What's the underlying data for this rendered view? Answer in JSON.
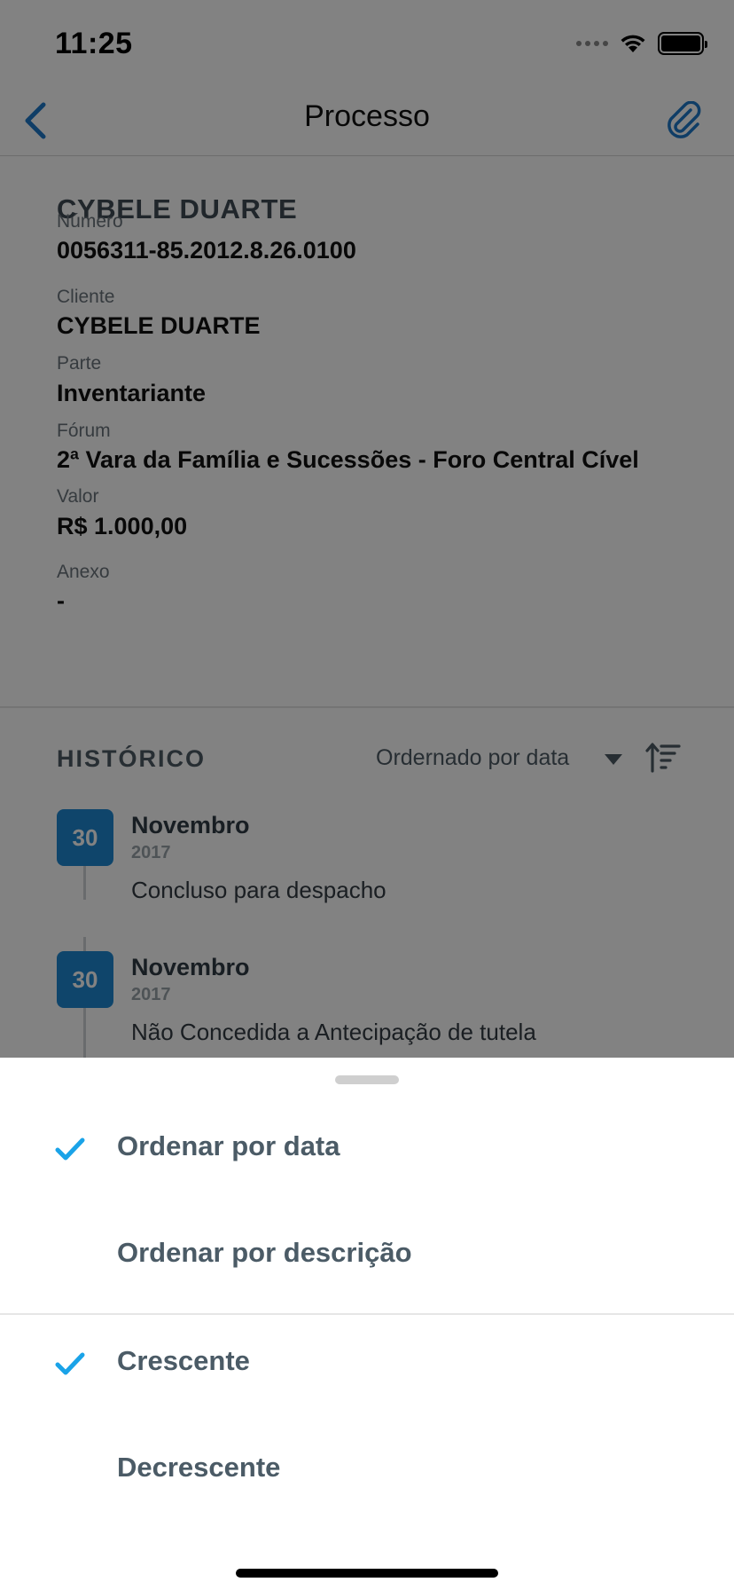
{
  "status_bar": {
    "time": "11:25"
  },
  "nav": {
    "title": "Processo",
    "back_icon": "chevron-left-icon",
    "attach_icon": "paperclip-icon",
    "accent_color": "#1e78c8"
  },
  "process": {
    "client_title": "CYBELE DUARTE",
    "fields": [
      {
        "label": "Número",
        "value": "0056311-85.2012.8.26.0100"
      },
      {
        "label": "Cliente",
        "value": "CYBELE DUARTE"
      },
      {
        "label": "Parte",
        "value": "Inventariante"
      },
      {
        "label": "Fórum",
        "value": "2ª Vara da Família e Sucessões - Foro Central Cível"
      },
      {
        "label": "Valor",
        "value": "R$ 1.000,00"
      },
      {
        "label": "Anexo",
        "value": "-"
      }
    ]
  },
  "history": {
    "title": "HISTÓRICO",
    "sort_label": "Ordernado por data",
    "entries": [
      {
        "day": "30",
        "month": "Novembro",
        "year": "2017",
        "description": "Concluso para despacho"
      },
      {
        "day": "30",
        "month": "Novembro",
        "year": "2017",
        "description": "Não Concedida a Antecipação de tutela"
      }
    ]
  },
  "sort_sheet": {
    "options": [
      {
        "label": "Ordenar por data",
        "checked": true
      },
      {
        "label": "Ordenar por descrição",
        "checked": false
      },
      {
        "label": "Crescente",
        "checked": true
      },
      {
        "label": "Decrescente",
        "checked": false
      }
    ],
    "check_color": "#1aa3e8"
  },
  "colors": {
    "badge": "#1e88d2",
    "overlay": "rgba(0,0,0,0.49)"
  }
}
